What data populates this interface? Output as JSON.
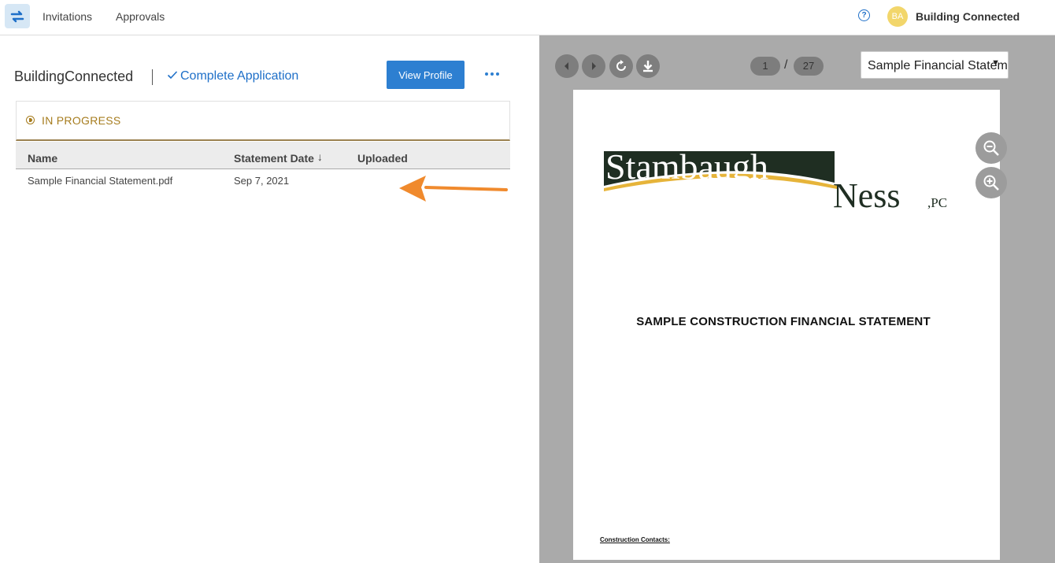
{
  "nav": {
    "links": [
      "Invitations",
      "Approvals"
    ],
    "help_glyph": "?",
    "avatar_initials": "BA",
    "user_name": "Building Connected"
  },
  "header": {
    "company": "BuildingConnected",
    "complete_label": "Complete Application",
    "view_profile": "View Profile"
  },
  "status": {
    "label": "IN PROGRESS"
  },
  "table": {
    "columns": [
      "Name",
      "Statement Date",
      "Uploaded"
    ],
    "sort_indicator": "↓",
    "rows": [
      {
        "name": "Sample Financial Statement.pdf",
        "date": "Sep 7, 2021",
        "uploaded": ""
      }
    ]
  },
  "viewer": {
    "current_page": "1",
    "total_pages": "27",
    "separator": "/",
    "file_name": "Sample Financial Statement",
    "document": {
      "logo_top": "Stambaugh",
      "logo_bottom": "Ness",
      "logo_suffix": ",PC",
      "title": "SAMPLE CONSTRUCTION FINANCIAL STATEMENT",
      "contacts": "Construction Contacts:"
    }
  },
  "colors": {
    "accent": "#2d7fd1",
    "status": "#a67c1e",
    "arrow": "#f08a2d",
    "logo_dark": "#1f2e22",
    "logo_gold": "#e6b43a"
  }
}
